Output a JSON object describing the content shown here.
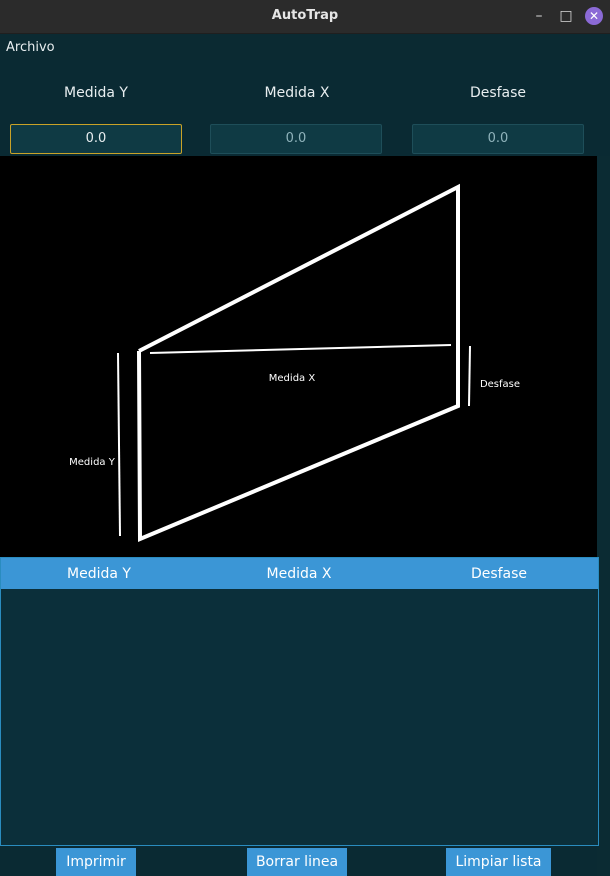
{
  "window": {
    "title": "AutoTrap"
  },
  "menu": {
    "archivo": "Archivo"
  },
  "inputs": {
    "headers": {
      "y": "Medida Y",
      "x": "Medida X",
      "d": "Desfase"
    },
    "values": {
      "y": "0.0",
      "x": "0.0",
      "d": "0.0"
    }
  },
  "diagram": {
    "label_x": "Medida X",
    "label_y": "Medida Y",
    "label_d": "Desfase"
  },
  "table": {
    "columns": {
      "y": "Medida Y",
      "x": "Medida X",
      "d": "Desfase"
    },
    "rows": []
  },
  "buttons": {
    "print": "Imprimir",
    "delete": "Borrar linea",
    "clear": "Limpiar lista"
  },
  "colors": {
    "accent": "#3b96d6",
    "background": "#0a2a33",
    "focus": "#c9a227"
  },
  "icons": {
    "minimize": "minimize-icon",
    "maximize": "maximize-icon",
    "close": "close-icon"
  }
}
